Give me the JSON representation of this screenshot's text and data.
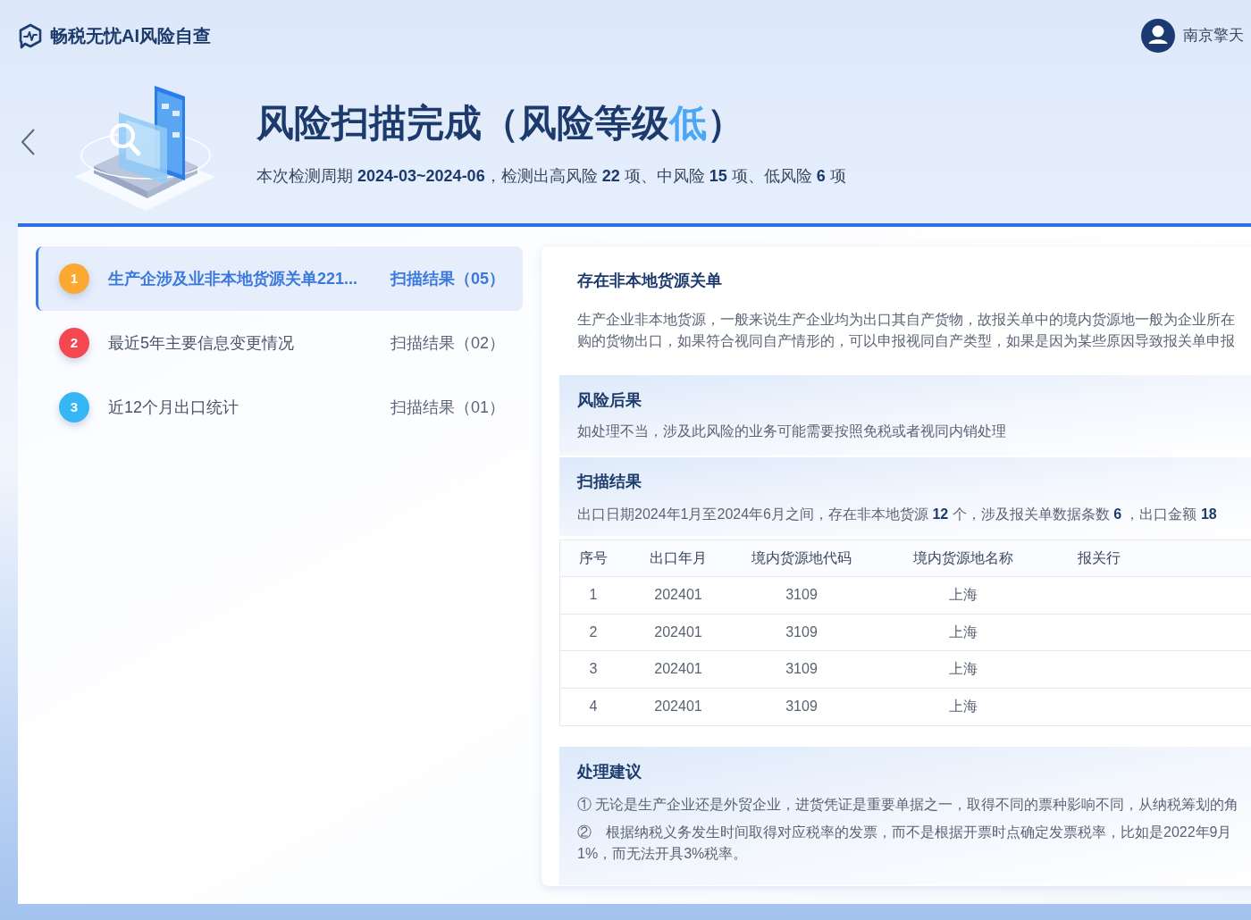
{
  "header": {
    "brand": "畅税无忧AI风险自查",
    "user_name": "南京擎天"
  },
  "hero": {
    "title_prefix": "风险扫描完成（风险等级",
    "risk_level_text": "低",
    "title_suffix": "）",
    "summary": "本次检测周期 **2024-03~2024-06**，检测出高风险 **22** 项、中风险 **15** 项、低风险 **6** 项"
  },
  "risk_items": [
    {
      "number": "1",
      "color": "#fca933",
      "title": "生产企涉及业非本地货源关单221...",
      "result": "扫描结果（05）",
      "selected": true
    },
    {
      "number": "2",
      "color": "#f4474f",
      "title": "最近5年主要信息变更情况",
      "result": "扫描结果（02）",
      "selected": false
    },
    {
      "number": "3",
      "color": "#36b6f5",
      "title": "近12个月出口统计",
      "result": "扫描结果（01）",
      "selected": false
    }
  ],
  "detail": {
    "description": {
      "title": "存在非本地货源关单",
      "lines": [
        "生产企业非本地货源，一般来说生产企业均为出口其自产货物，故报关单中的境内货源地一般为企业所在",
        "购的货物出口，如果符合视同自产情形的，可以申报视同自产类型，如果是因为某些原因导致报关单申报"
      ]
    },
    "consequence": {
      "title": "风险后果",
      "text": "如处理不当，涉及此风险的业务可能需要按照免税或者视同内销处理"
    },
    "scan_result": {
      "title": "扫描结果",
      "summary": "出口日期2024年1月至2024年6月之间，存在非本地货源 **12** 个，涉及报关单数据条数 **6** ，出口金额 **18**",
      "table": {
        "columns": [
          "序号",
          "出口年月",
          "境内货源地代码",
          "境内货源地名称",
          "报关行"
        ],
        "rows": [
          [
            "1",
            "202401",
            "3109",
            "上海"
          ],
          [
            "2",
            "202401",
            "3109",
            "上海"
          ],
          [
            "3",
            "202401",
            "3109",
            "上海"
          ],
          [
            "4",
            "202401",
            "3109",
            "上海"
          ]
        ]
      }
    },
    "advice": {
      "title": "处理建议",
      "items": [
        {
          "lines": [
            "① 无论是生产企业还是外贸企业，进货凭证是重要单据之一，取得不同的票种影响不同，从纳税筹划的角"
          ]
        },
        {
          "lines": [
            "②　根据纳税义务发生时间取得对应税率的发票，而不是根据开票时点确定发票税率，比如是2022年9月",
            "1%，而无法开具3%税率。"
          ]
        }
      ]
    }
  }
}
